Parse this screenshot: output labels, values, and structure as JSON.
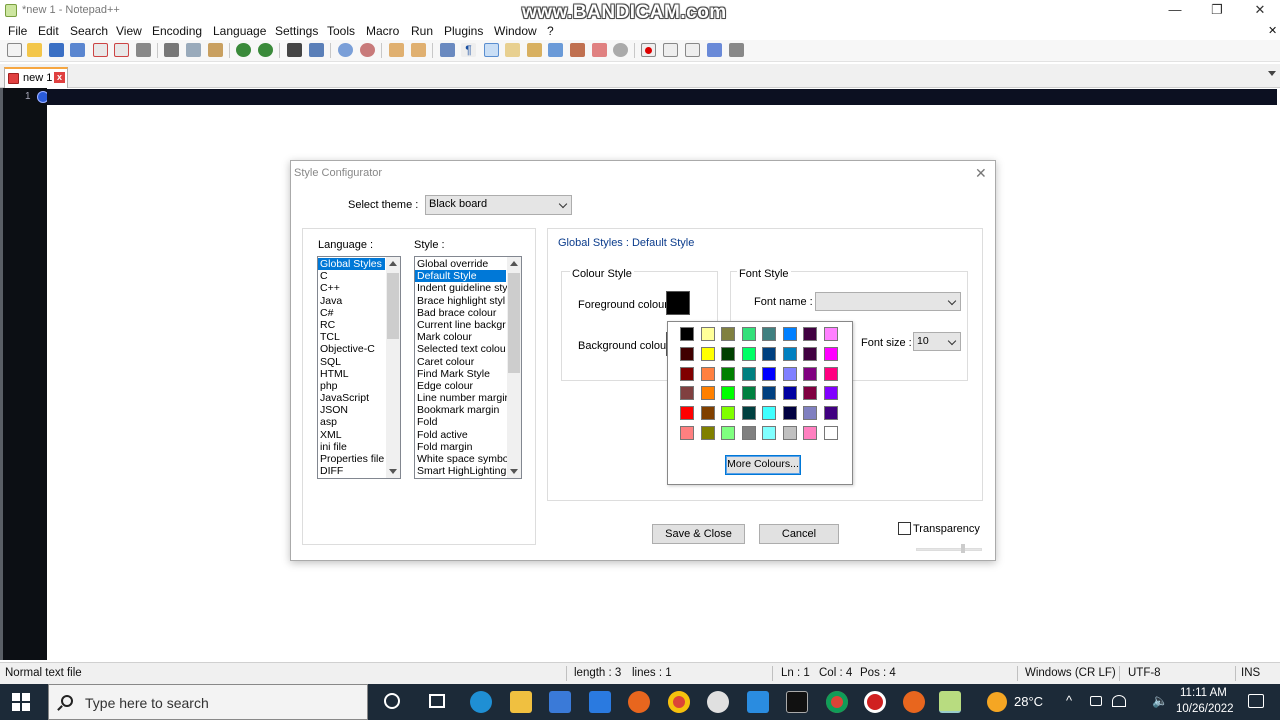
{
  "window": {
    "title": "*new 1 - Notepad++",
    "watermark": "www.BANDICAM.com",
    "controls": {
      "minimize": "—",
      "restore": "❐",
      "close": "✕"
    }
  },
  "menu": [
    "File",
    "Edit",
    "Search",
    "View",
    "Encoding",
    "Language",
    "Settings",
    "Tools",
    "Macro",
    "Run",
    "Plugins",
    "Window",
    "?"
  ],
  "menu_close": "✕",
  "tab": {
    "label": "new 1",
    "close": "x"
  },
  "editor": {
    "line_number": "1"
  },
  "dialog": {
    "title": "Style Configurator",
    "close": "✕",
    "theme_label": "Select theme :",
    "theme_value": "Black board",
    "language_label": "Language :",
    "style_label": "Style :",
    "languages": [
      "Global Styles",
      "C",
      "C++",
      "Java",
      "C#",
      "RC",
      "TCL",
      "Objective-C",
      "SQL",
      "HTML",
      "php",
      "JavaScript",
      "JSON",
      "asp",
      "XML",
      "ini file",
      "Properties file",
      "DIFF"
    ],
    "styles": [
      "Global override",
      "Default Style",
      "Indent guideline sty",
      "Brace highlight styl",
      "Bad brace colour",
      "Current line backgr",
      "Mark colour",
      "Selected text colou",
      "Caret colour",
      "Find Mark Style",
      "Edge colour",
      "Line number margir",
      "Bookmark margin",
      "Fold",
      "Fold active",
      "Fold margin",
      "White space symbo",
      "Smart HighLighting"
    ],
    "heading": "Global Styles : Default Style",
    "colour_style": "Colour Style",
    "foreground_colour": "Foreground colour",
    "background_colour": "Background colour",
    "font_style": "Font Style",
    "font_name": "Font name :",
    "font_size_label": "Font size :",
    "font_size_value": "10",
    "save_close": "Save & Close",
    "cancel": "Cancel",
    "transparency": "Transparency"
  },
  "colour_picker": {
    "swatches": [
      [
        "#000000",
        "#ffff99",
        "#808040",
        "#33e07a",
        "#408080",
        "#0080ff",
        "#400040",
        "#ff80ff"
      ],
      [
        "#400000",
        "#ffff00",
        "#004000",
        "#00ff66",
        "#004080",
        "#0080c0",
        "#400040",
        "#ff00ff"
      ],
      [
        "#800000",
        "#ff8040",
        "#008000",
        "#008080",
        "#0000ff",
        "#8080ff",
        "#800080",
        "#ff0080"
      ],
      [
        "#804040",
        "#ff8000",
        "#00ff00",
        "#008040",
        "#004080",
        "#0000a0",
        "#800040",
        "#8000ff"
      ],
      [
        "#ff0000",
        "#804000",
        "#80ff00",
        "#004040",
        "#40ffff",
        "#000040",
        "#8080c0",
        "#400080"
      ],
      [
        "#ff8080",
        "#808000",
        "#80ff80",
        "#808080",
        "#80ffff",
        "#c0c0c0",
        "#ff80c0",
        "#ffffff"
      ]
    ],
    "more_colours": "More Colours..."
  },
  "status": {
    "file_type": "Normal text file",
    "length": "length : 3",
    "lines": "lines : 1",
    "ln": "Ln : 1",
    "col": "Col : 4",
    "pos": "Pos : 4",
    "eol": "Windows (CR LF)",
    "encoding": "UTF-8",
    "mode": "INS"
  },
  "taskbar": {
    "search_placeholder": "Type here to search",
    "temperature": "28°C",
    "time": "11:11 AM",
    "date": "10/26/2022",
    "tray_chevron": "^",
    "tray_speaker": "🔈"
  }
}
